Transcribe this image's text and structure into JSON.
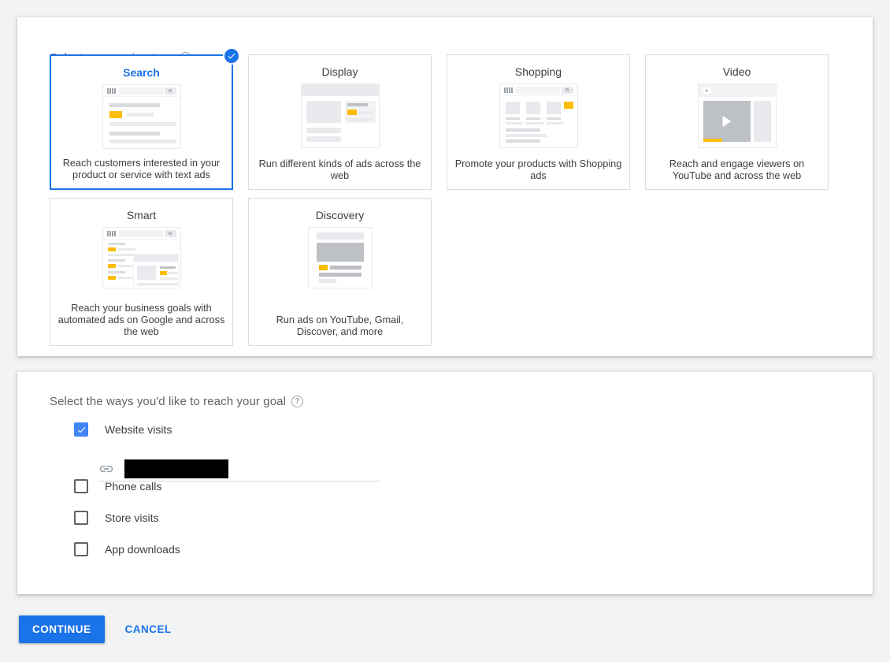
{
  "campaign_type_section": {
    "heading": "Select a campaign type",
    "help_icon": "help-circle-icon",
    "selected_type": "Search",
    "cards": [
      {
        "title": "Search",
        "description": "Reach customers interested in your product or service with text ads",
        "selected": true,
        "badge_icon": "check-circle-icon"
      },
      {
        "title": "Display",
        "description": "Run different kinds of ads across the web",
        "selected": false
      },
      {
        "title": "Shopping",
        "description": "Promote your products with Shopping ads",
        "selected": false
      },
      {
        "title": "Video",
        "description": "Reach and engage viewers on YouTube and across the web",
        "selected": false
      },
      {
        "title": "Smart",
        "description": "Reach your business goals with automated ads on Google and across the web",
        "selected": false
      },
      {
        "title": "Discovery",
        "description": "Run ads on YouTube, Gmail, Discover, and more",
        "selected": false
      }
    ]
  },
  "goal_ways_section": {
    "heading": "Select the ways you'd like to reach your goal",
    "help_icon": "help-circle-icon",
    "options": [
      {
        "label": "Website visits",
        "checked": true
      },
      {
        "label": "Phone calls",
        "checked": false
      },
      {
        "label": "Store visits",
        "checked": false
      },
      {
        "label": "App downloads",
        "checked": false
      }
    ],
    "website_url_field": {
      "icon": "link-icon",
      "value": "",
      "placeholder": "",
      "redacted": true
    }
  },
  "footer": {
    "continue_label": "CONTINUE",
    "cancel_label": "CANCEL"
  },
  "colors": {
    "accent": "#1a73e8",
    "checkbox_checked": "#4285f4",
    "yellow": "#fbbc04",
    "page_background": "#f1f3f4",
    "panel_background": "#ffffff",
    "text_primary": "#3c4043",
    "text_secondary": "#5f6368",
    "border": "#dadce0"
  }
}
